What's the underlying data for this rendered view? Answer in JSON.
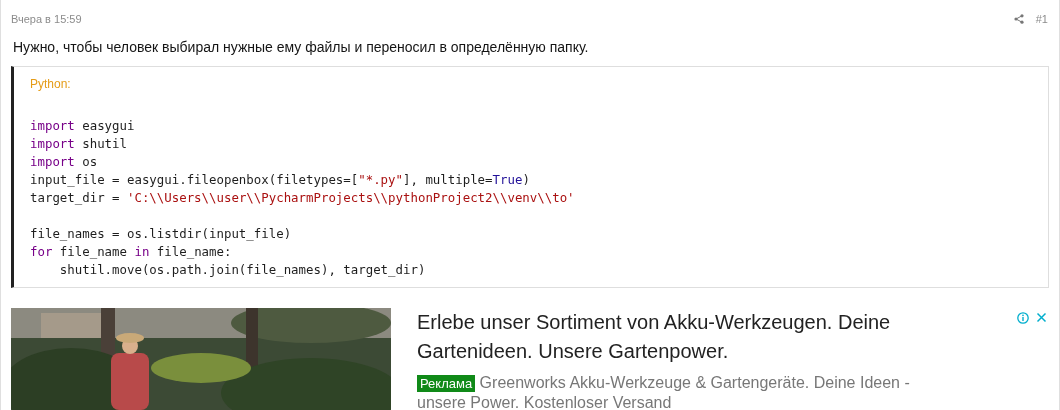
{
  "post": {
    "time": "Вчера в 15:59",
    "number": "#1",
    "text": "Нужно, чтобы человек выбирал нужные ему файлы и переносил в определённую папку."
  },
  "code_block": {
    "language": "Python:",
    "lines": [
      {
        "kind": "blank"
      },
      {
        "kind": "code",
        "tokens": [
          {
            "kind": "keyword",
            "t": "import"
          },
          {
            "kind": "plain",
            "t": " easygui"
          }
        ]
      },
      {
        "kind": "code",
        "tokens": [
          {
            "kind": "keyword",
            "t": "import"
          },
          {
            "kind": "plain",
            "t": " shutil"
          }
        ]
      },
      {
        "kind": "code",
        "tokens": [
          {
            "kind": "keyword",
            "t": "import"
          },
          {
            "kind": "plain",
            "t": " os"
          }
        ]
      },
      {
        "kind": "code",
        "tokens": [
          {
            "kind": "plain",
            "t": "input_file = easygui.fileopenbox(filetypes=["
          },
          {
            "kind": "string",
            "t": "\"*.py\""
          },
          {
            "kind": "plain",
            "t": "], multiple="
          },
          {
            "kind": "constant",
            "t": "True"
          },
          {
            "kind": "plain",
            "t": ")"
          }
        ]
      },
      {
        "kind": "code",
        "tokens": [
          {
            "kind": "plain",
            "t": "target_dir = "
          },
          {
            "kind": "string",
            "t": "'C:\\\\Users\\\\user\\\\PycharmProjects\\\\pythonProject2\\\\venv\\\\to'"
          }
        ]
      },
      {
        "kind": "blank"
      },
      {
        "kind": "code",
        "tokens": [
          {
            "kind": "plain",
            "t": "file_names = os.listdir(input_file)"
          }
        ]
      },
      {
        "kind": "code",
        "tokens": [
          {
            "kind": "keyword",
            "t": "for"
          },
          {
            "kind": "plain",
            "t": " file_name "
          },
          {
            "kind": "keyword",
            "t": "in"
          },
          {
            "kind": "plain",
            "t": " file_name:"
          }
        ]
      },
      {
        "kind": "code",
        "tokens": [
          {
            "kind": "plain",
            "t": "    shutil.move(os.path.join(file_names), target_dir)"
          }
        ]
      }
    ]
  },
  "ad": {
    "headline": "Erlebe unser Sortiment von Akku-Werkzeugen. Deine Gartenideen. Unsere Gartenpower.",
    "badge": "Реклама",
    "description": "Greenworks Akku-Werkzeuge & Gartengeräte. Deine Ideen - unsere Power. Kostenloser Versand"
  }
}
